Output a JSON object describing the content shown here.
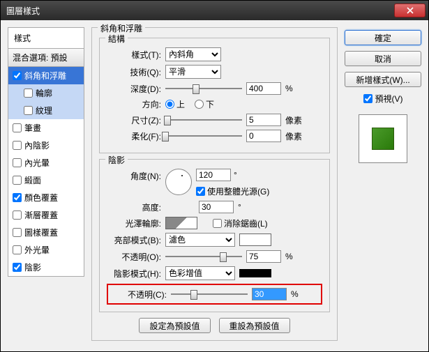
{
  "window": {
    "title": "圖層樣式"
  },
  "left": {
    "styleHeader": "樣式",
    "blendHeader": "混合選項: 預設",
    "items": [
      {
        "label": "斜角和浮雕",
        "checked": true,
        "sel": true,
        "indent": false
      },
      {
        "label": "輪廓",
        "checked": false,
        "sel": false,
        "indent": true,
        "hl": true
      },
      {
        "label": "紋理",
        "checked": false,
        "sel": false,
        "indent": true,
        "hl": true
      },
      {
        "label": "筆畫",
        "checked": false,
        "sel": false,
        "indent": false
      },
      {
        "label": "內陰影",
        "checked": false,
        "sel": false,
        "indent": false
      },
      {
        "label": "內光暈",
        "checked": false,
        "sel": false,
        "indent": false
      },
      {
        "label": "緞面",
        "checked": false,
        "sel": false,
        "indent": false
      },
      {
        "label": "顏色覆蓋",
        "checked": true,
        "sel": false,
        "indent": false
      },
      {
        "label": "漸層覆蓋",
        "checked": false,
        "sel": false,
        "indent": false
      },
      {
        "label": "圖樣覆蓋",
        "checked": false,
        "sel": false,
        "indent": false
      },
      {
        "label": "外光暈",
        "checked": false,
        "sel": false,
        "indent": false
      },
      {
        "label": "陰影",
        "checked": true,
        "sel": false,
        "indent": false
      }
    ]
  },
  "mid": {
    "mainLegend": "斜角和浮雕",
    "structLegend": "結構",
    "shadowLegend": "陰影",
    "styleLbl": "樣式(T):",
    "styleVal": "內斜角",
    "techLbl": "技術(Q):",
    "techVal": "平滑",
    "depthLbl": "深度(D):",
    "depthVal": "400",
    "depthUnit": "%",
    "dirLbl": "方向:",
    "dirUp": "上",
    "dirDown": "下",
    "sizeLbl": "尺寸(Z):",
    "sizeVal": "5",
    "sizeUnit": "像素",
    "softLbl": "柔化(F):",
    "softVal": "0",
    "softUnit": "像素",
    "angleLbl": "角度(N):",
    "angleVal": "120",
    "angleUnit": "°",
    "globalLight": "使用整體光源(G)",
    "altLbl": "高度:",
    "altVal": "30",
    "altUnit": "°",
    "glossLbl": "光澤輪廓:",
    "antiAlias": "消除鋸齒(L)",
    "hiLbl": "亮部模式(B):",
    "hiMode": "濾色",
    "hiOpLbl": "不透明(O):",
    "hiOpVal": "75",
    "hiOpUnit": "%",
    "shLbl": "陰影模式(H):",
    "shMode": "色彩增值",
    "shOpLbl": "不透明(C):",
    "shOpVal": "30",
    "shOpUnit": "%",
    "defaultBtn": "設定為預設值",
    "resetBtn": "重設為預設值"
  },
  "right": {
    "ok": "確定",
    "cancel": "取消",
    "newStyle": "新增樣式(W)...",
    "preview": "預視(V)"
  }
}
